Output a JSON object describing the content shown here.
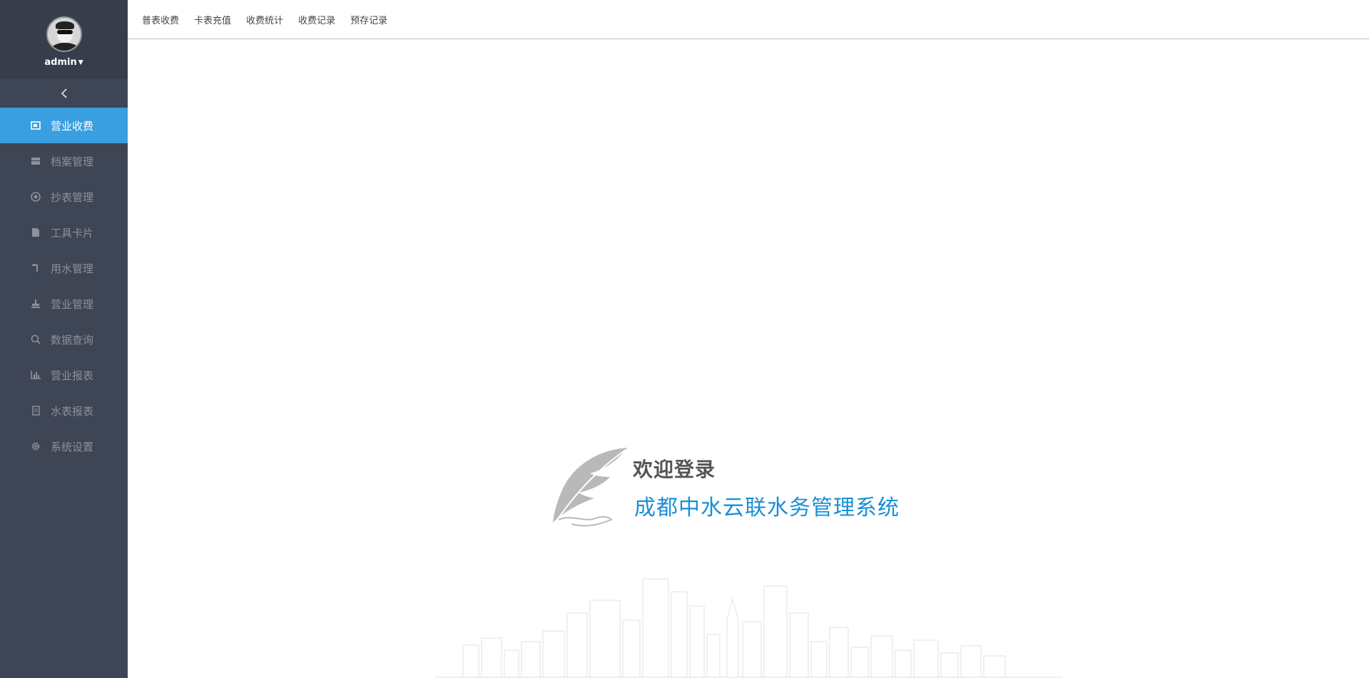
{
  "user": {
    "name": "admin"
  },
  "sidebar": {
    "items": [
      {
        "label": "营业收费",
        "icon": "cashier-icon",
        "active": true
      },
      {
        "label": "档案管理",
        "icon": "archive-icon"
      },
      {
        "label": "抄表管理",
        "icon": "meter-icon"
      },
      {
        "label": "工具卡片",
        "icon": "card-icon"
      },
      {
        "label": "用水管理",
        "icon": "faucet-icon"
      },
      {
        "label": "营业管理",
        "icon": "stamp-icon"
      },
      {
        "label": "数据查询",
        "icon": "search-icon"
      },
      {
        "label": "营业报表",
        "icon": "bar-chart-icon"
      },
      {
        "label": "水表报表",
        "icon": "report-icon"
      },
      {
        "label": "系统设置",
        "icon": "gear-icon"
      }
    ]
  },
  "tabs": [
    "普表收费",
    "卡表充值",
    "收费统计",
    "收费记录",
    "预存记录"
  ],
  "welcome": {
    "title": "欢迎登录",
    "subtitle": "成都中水云联水务管理系统"
  },
  "colors": {
    "sidebar_bg": "#3e4555",
    "sidebar_header_bg": "#373d4b",
    "active_item": "#3a9fe0",
    "subtitle": "#1a8fd6"
  }
}
